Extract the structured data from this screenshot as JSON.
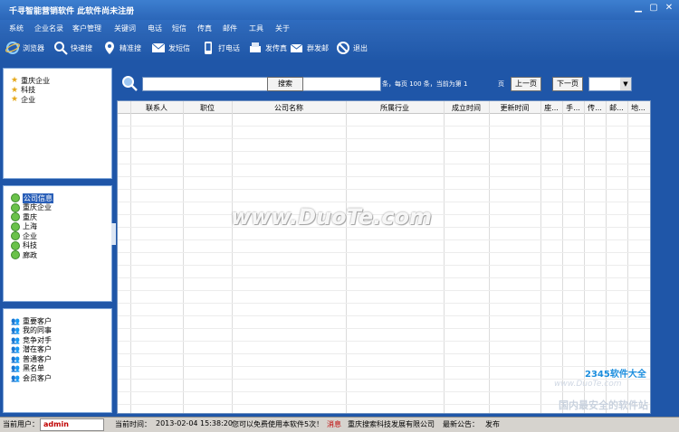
{
  "window": {
    "title": "千寻智能营销软件 此软件尚未注册",
    "controls": [
      "minimize-icon",
      "maximize-icon",
      "close-icon"
    ]
  },
  "menu": [
    "系统",
    "企业名录",
    "客户管理",
    "关键词",
    "电话",
    "短信",
    "传真",
    "邮件",
    "工具",
    "关于"
  ],
  "toolbar": [
    {
      "label": "浏览器",
      "icon": "ie-icon"
    },
    {
      "label": "快速搜",
      "icon": "search-icon"
    },
    {
      "label": "精准搜",
      "icon": "map-pin-icon"
    },
    {
      "label": "发短信",
      "icon": "envelope-icon"
    },
    {
      "label": "打电话",
      "icon": "phone-icon"
    },
    {
      "label": "发传真",
      "icon": "fax-icon"
    },
    {
      "label": "群发邮",
      "icon": "mail-icon"
    },
    {
      "label": "退出",
      "icon": "exit-icon"
    }
  ],
  "panel1": {
    "items": [
      "重庆企业",
      "科技",
      "企业"
    ]
  },
  "panel2": {
    "items": [
      "公司信息",
      "重庆企业",
      "重庆",
      "上海",
      "企业",
      "科技",
      "廊政"
    ],
    "selected": 0
  },
  "panel3": {
    "items": [
      "重要客户",
      "我的同事",
      "竞争对手",
      "潜在客户",
      "普通客户",
      "黑名单",
      "会员客户"
    ]
  },
  "search": {
    "value": "",
    "button": "搜索",
    "found": "找到的：0",
    "paging": "条，每页 100 条，当前为第 1",
    "page_unit": "页",
    "prev": "上一页",
    "next": "下一页",
    "page_select": ""
  },
  "grid": {
    "columns": [
      "联系人",
      "职位",
      "公司名称",
      "所属行业",
      "成立时间",
      "更新时间",
      "座...",
      "手...",
      "传...",
      "邮...",
      "地..."
    ],
    "rows": []
  },
  "watermark": {
    "main": "www.DuoTe.com",
    "brand": "2345软件大全",
    "sub": "www.DuoTe.com",
    "bottom": "国内最安全的软件站"
  },
  "statusbar": {
    "user_label": "当前用户：",
    "user": "admin",
    "time_label": "当前时间：",
    "time": "2013-02-04 15:38:20",
    "trial": "您可以免费使用本软件5次！",
    "msg": "消息",
    "company": "重庆搜索科技发展有限公司",
    "notice_label": "最新公告：",
    "notice": "发布"
  }
}
